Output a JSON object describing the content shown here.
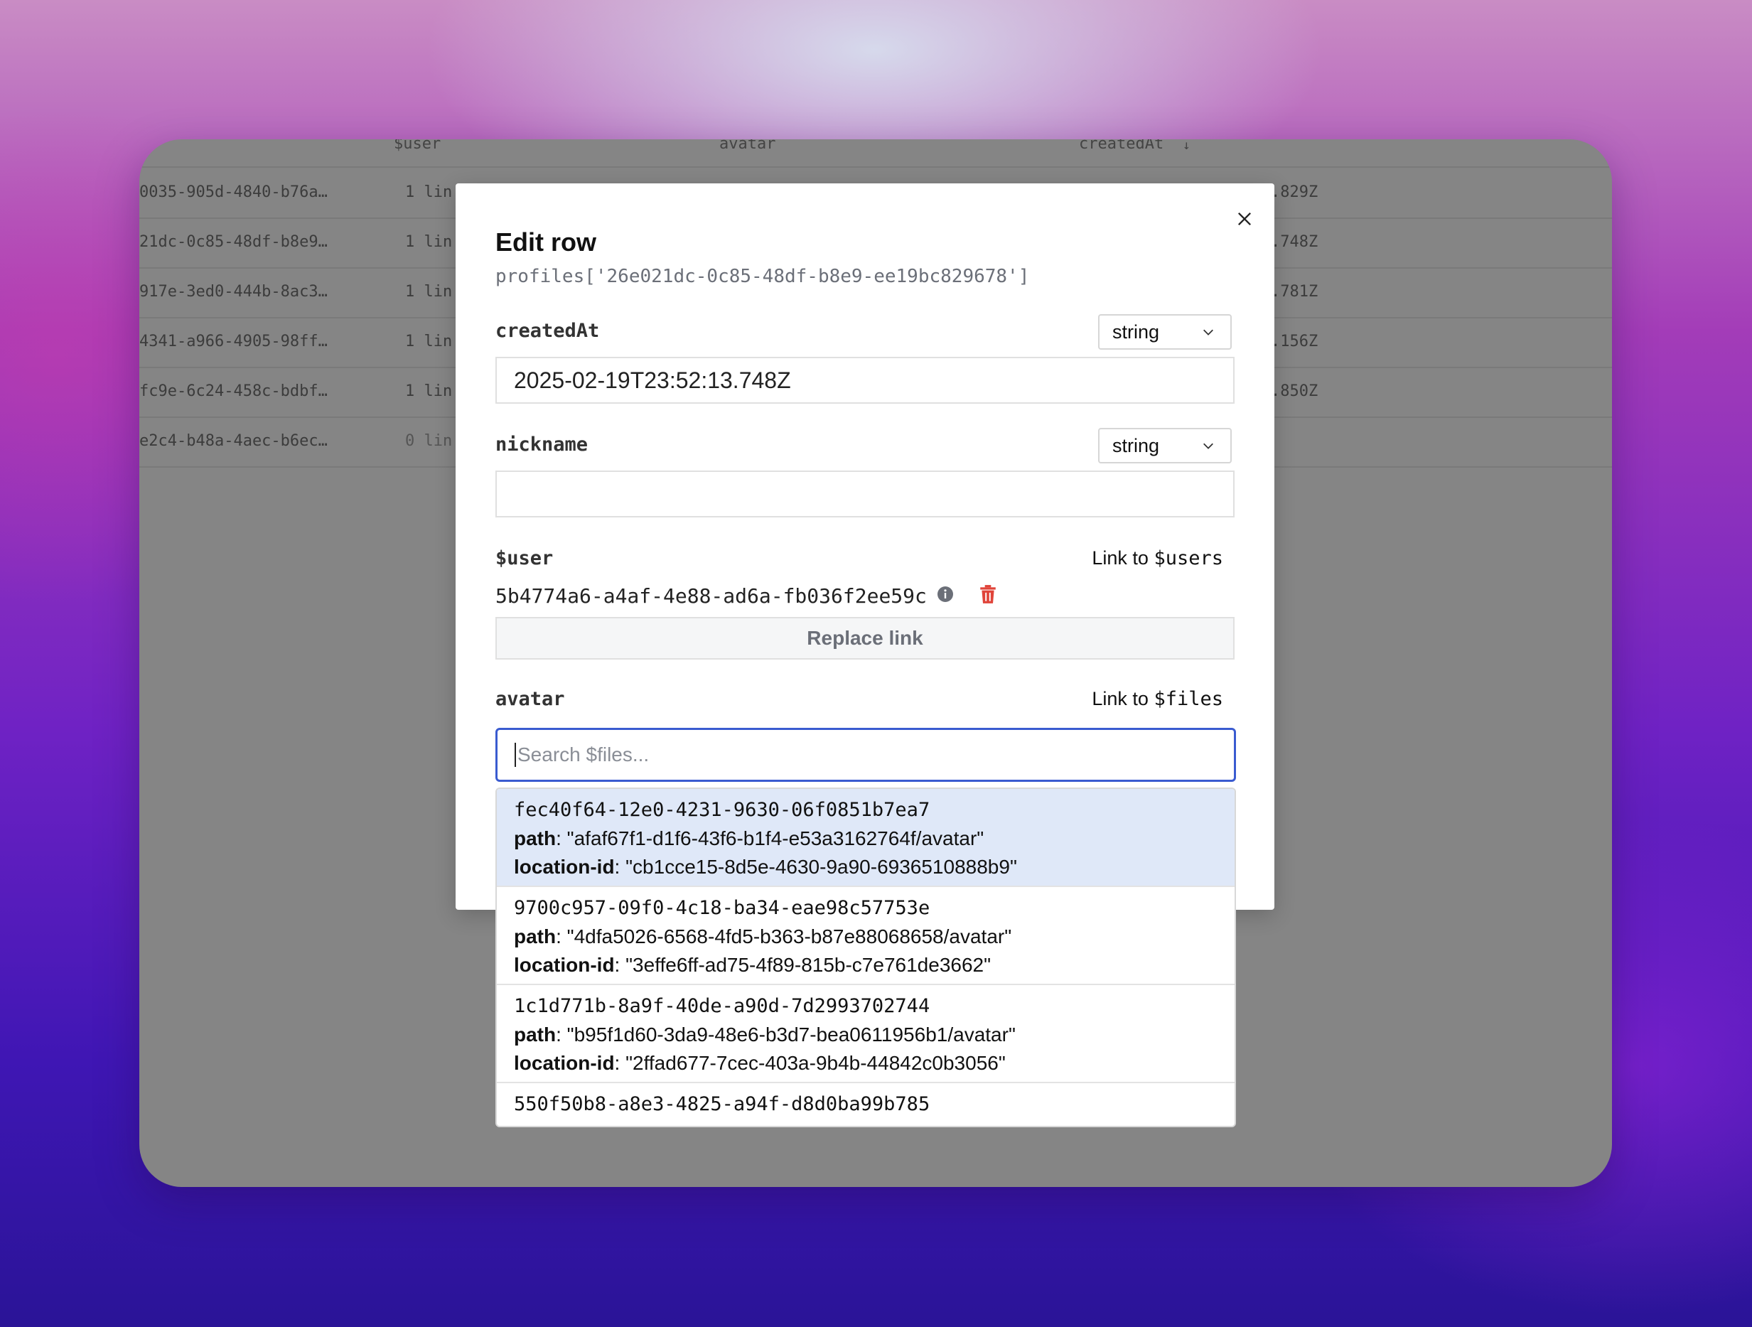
{
  "background_table": {
    "headers": [
      "$user",
      "avatar",
      "createdAt"
    ],
    "rows": [
      {
        "id": "0035-905d-4840-b76a…",
        "links": "1 lin",
        "date": ".829Z"
      },
      {
        "id": "21dc-0c85-48df-b8e9…",
        "links": "1 lin",
        "date": ".748Z"
      },
      {
        "id": "917e-3ed0-444b-8ac3…",
        "links": "1 lin",
        "date": ".781Z"
      },
      {
        "id": "4341-a966-4905-98ff…",
        "links": "1 lin",
        "date": ".156Z"
      },
      {
        "id": "fc9e-6c24-458c-bdbf…",
        "links": "1 lin",
        "date": ".850Z"
      },
      {
        "id": "e2c4-b48a-4aec-b6ec…",
        "links": "0 lin",
        "date": ""
      }
    ]
  },
  "modal": {
    "title": "Edit row",
    "subtitle": "profiles['26e021dc-0c85-48df-b8e9-ee19bc829678']",
    "fields": {
      "createdAt": {
        "label": "createdAt",
        "type": "string",
        "value": "2025-02-19T23:52:13.748Z"
      },
      "nickname": {
        "label": "nickname",
        "type": "string",
        "value": ""
      },
      "user": {
        "label": "$user",
        "link_prefix": "Link to ",
        "link_target": "$users",
        "linked_id": "5b4774a6-a4af-4e88-ad6a-fb036f2ee59c",
        "replace_label": "Replace link"
      },
      "avatar": {
        "label": "avatar",
        "link_prefix": "Link to ",
        "link_target": "$files",
        "search_placeholder": "Search $files..."
      }
    }
  },
  "dropdown": {
    "path_key": "path",
    "location_key": "location-id",
    "options": [
      {
        "id": "fec40f64-12e0-4231-9630-06f0851b7ea7",
        "path": ": \"afaf67f1-d1f6-43f6-b1f4-e53a3162764f/avatar\"",
        "location": ": \"cb1cce15-8d5e-4630-9a90-6936510888b9\""
      },
      {
        "id": "9700c957-09f0-4c18-ba34-eae98c57753e",
        "path": ": \"4dfa5026-6568-4fd5-b363-b87e88068658/avatar\"",
        "location": ": \"3effe6ff-ad75-4f89-815b-c7e761de3662\""
      },
      {
        "id": "1c1d771b-8a9f-40de-a90d-7d2993702744",
        "path": ": \"b95f1d60-3da9-48e6-b3d7-bea0611956b1/avatar\"",
        "location": ": \"2ffad677-7cec-403a-9b4b-44842c0b3056\""
      },
      {
        "id": "550f50b8-a8e3-4825-a94f-d8d0ba99b785",
        "path": "",
        "location": ""
      }
    ]
  },
  "colors": {
    "accent": "#3a5bd0",
    "danger": "#e0443a",
    "highlight": "#dfe8f8"
  }
}
